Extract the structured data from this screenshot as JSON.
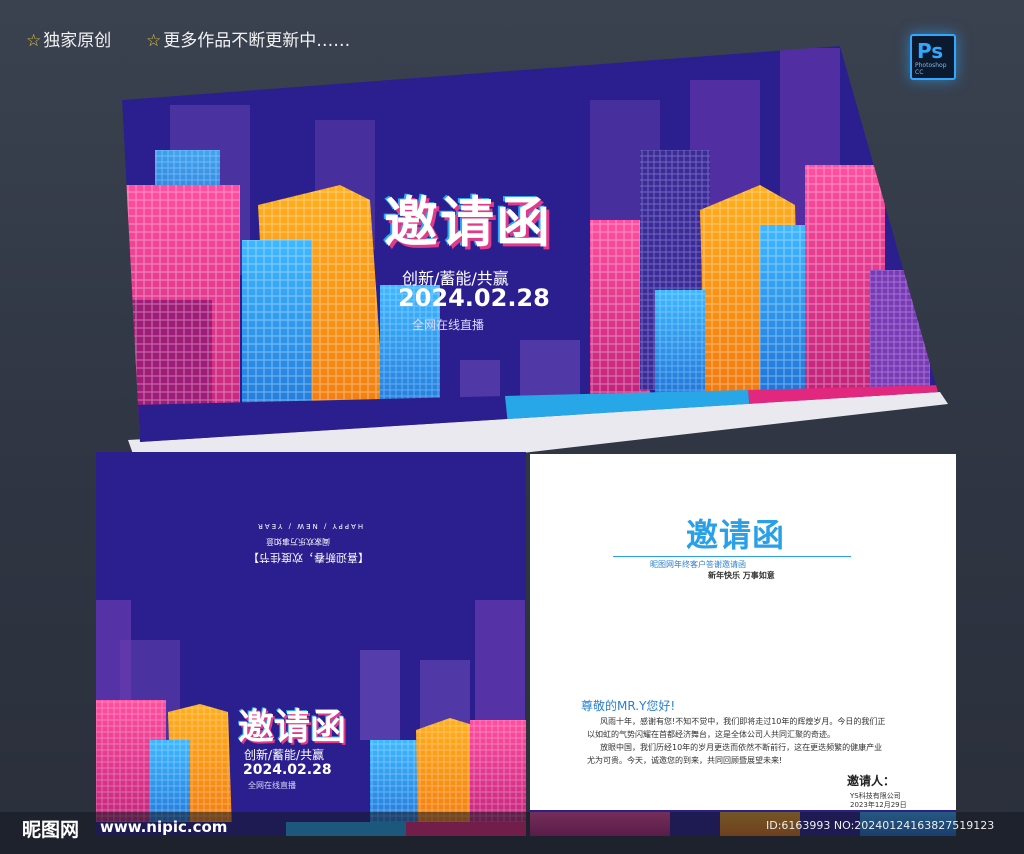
{
  "header": {
    "tag1": "独家原创",
    "tag2": "更多作品不断更新中……",
    "star": "☆",
    "ps_label": "Ps",
    "ps_sub": "Photoshop CC"
  },
  "card_top": {
    "title": "邀请函",
    "subtitle": "创新/蓄能/共赢",
    "date": "2024.02.28",
    "live": "全网在线直播"
  },
  "card_bottom_left": {
    "title": "邀请函",
    "subtitle": "创新/蓄能/共赢",
    "date": "2024.02.28",
    "live": "全网在线直播",
    "flipped_1": "HAPPY / NEW / YEAR",
    "flipped_2": "阖家欢乐万事如意",
    "flipped_3": "【喜迎新春，欢度佳节】"
  },
  "letter": {
    "title": "邀请函",
    "subtitle": "昵图网年终客户答谢邀请函",
    "subtitle2": "新年快乐 万事如意",
    "greeting": "尊敬的MR.Y您好!",
    "lines": [
      "风雨十年，感谢有您!不知不觉中，我们即将走过10年的辉煌岁月。今日的我们正",
      "以如虹的气势闪耀在首都经济舞台，这是全体公司人共同汇聚的奇迹。",
      "放眼中国，我们历经10年的岁月更迭而依然不断前行，这在更迭频繁的健康产业",
      "尤为可贵。今天，诚邀您的到来，共同回顾暨展望未来!"
    ],
    "inviter_label": "邀请人：",
    "company": "YS科技有限公司",
    "date": "2023年12月29日"
  },
  "footer": {
    "logo": "昵图网",
    "url": "www.nipic.com",
    "id_text": "ID:6163993 NO:20240124163827519123"
  },
  "colors": {
    "navy": "#2b1f8f",
    "pink": "#e2277f",
    "orange": "#f7931e",
    "blue": "#2aa6ff",
    "purple": "#6a2fa0"
  }
}
